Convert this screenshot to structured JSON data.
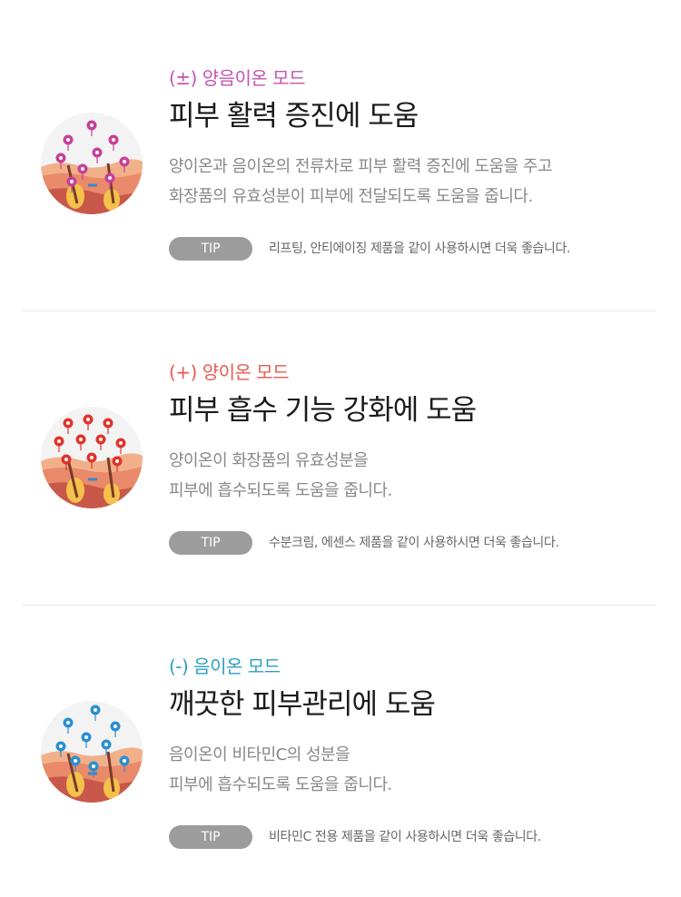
{
  "modes": [
    {
      "label": "(±) 양음이온 모드",
      "label_color": "#c453b4",
      "title": "피부 활력 증진에 도움",
      "description": [
        "양이온과 음이온의 전류차로 피부 활력 증진에 도움을 주고",
        "화장품의 유효성분이 피부에 전달되도록 도움을 줍니다."
      ],
      "tip_badge": "TIP",
      "tip_text": "리프팅, 안티에이징 제품을 같이 사용하시면 더욱 좋습니다.",
      "ion_color": "#c7409a"
    },
    {
      "label": "(+) 양이온 모드",
      "label_color": "#e85a4f",
      "title": "피부 흡수 기능 강화에 도움",
      "description": [
        "양이온이 화장품의 유효성분을",
        "피부에 흡수되도록 도움을 줍니다."
      ],
      "tip_badge": "TIP",
      "tip_text": "수분크림, 에센스 제품을 같이 사용하시면 더욱 좋습니다.",
      "ion_color": "#e0342c"
    },
    {
      "label": "(-) 음이온 모드",
      "label_color": "#2aa0bf",
      "title": "깨끗한 피부관리에 도움",
      "description": [
        "음이온이 비타민C의 성분을",
        "피부에 흡수되도록 도움을 줍니다."
      ],
      "tip_badge": "TIP",
      "tip_text": "비타민C 전용 제품을 같이 사용하시면 더욱 좋습니다.",
      "ion_color": "#2b8fd0"
    }
  ]
}
